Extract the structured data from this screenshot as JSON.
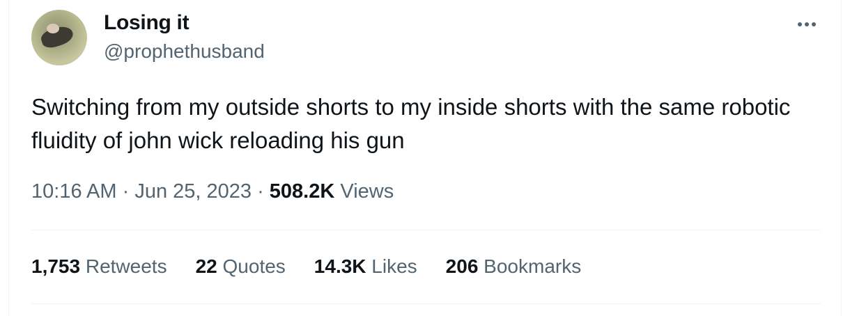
{
  "author": {
    "display_name": "Losing it",
    "handle": "@prophethusband"
  },
  "tweet": {
    "text": "Switching from my outside shorts to my inside shorts with the same robotic fluidity of john wick reloading his gun",
    "time": "10:16 AM",
    "sep1": " · ",
    "date": "Jun 25, 2023",
    "sep2": " · ",
    "views_count": "508.2K",
    "views_label": " Views"
  },
  "stats": [
    {
      "count": "1,753",
      "label": " Retweets"
    },
    {
      "count": "22",
      "label": " Quotes"
    },
    {
      "count": "14.3K",
      "label": " Likes"
    },
    {
      "count": "206",
      "label": " Bookmarks"
    }
  ],
  "colors": {
    "primary_text": "#0f1419",
    "secondary_text": "#536471",
    "divider": "#eff3f4"
  },
  "icons": {
    "more": "more-horizontal-icon"
  }
}
